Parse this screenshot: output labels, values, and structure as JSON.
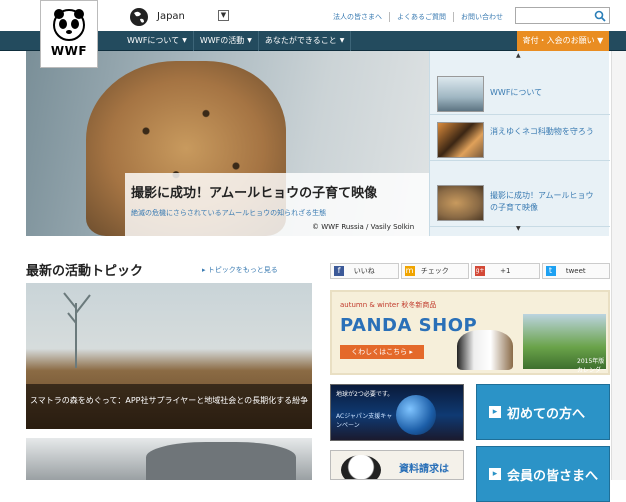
{
  "header": {
    "logo_text": "WWF",
    "region": "Japan",
    "top_links": [
      "法人の皆さまへ",
      "よくあるご質問",
      "お問い合わせ"
    ],
    "search": {
      "placeholder": ""
    }
  },
  "nav": {
    "items": [
      {
        "label": "WWFについて"
      },
      {
        "label": "WWFの活動"
      },
      {
        "label": "あなたができること"
      }
    ],
    "donate_label": "寄付・入会のお願い"
  },
  "hero": {
    "title": "撮影に成功！アムールヒョウの子育て映像",
    "subtitle": "絶滅の危機にさらされているアムールヒョウの知られざる生態",
    "credit": "© WWF Russia / Vasily Solkin"
  },
  "side_list": {
    "items": [
      {
        "label": "WWFについて"
      },
      {
        "label": "消えゆくネコ科動物を守ろう"
      },
      {
        "label": "撮影に成功！アムールヒョウの子育て映像"
      }
    ]
  },
  "topics": {
    "title": "最新の活動トピック",
    "more_link": "トピックをもっと見る",
    "news_title": "スマトラの森をめぐって：APP社サプライヤーと地域社会との長期化する紛争"
  },
  "share": {
    "buttons": [
      {
        "icon": "f",
        "label": "いいね",
        "color": "#3b5998"
      },
      {
        "icon": "m",
        "label": "チェック",
        "color": "#f0a400"
      },
      {
        "icon": "g+",
        "label": "+1",
        "color": "#d34836"
      },
      {
        "icon": "t",
        "label": "tweet",
        "color": "#1da1f2"
      }
    ]
  },
  "banner": {
    "kicker": "autumn & winter 秋冬新商品",
    "title": "PANDA SHOP",
    "button": "くわしくはこちら",
    "calendar_label": "2015年版カレンダー"
  },
  "city_ad": {
    "headline": "地球が2つ必要です。",
    "body": "ACジャパン支援キャンペーン"
  },
  "doc_ad": {
    "label": "資料請求は"
  },
  "blue_buttons": {
    "first": "初めての方へ",
    "members": "会員の皆さまへ"
  }
}
